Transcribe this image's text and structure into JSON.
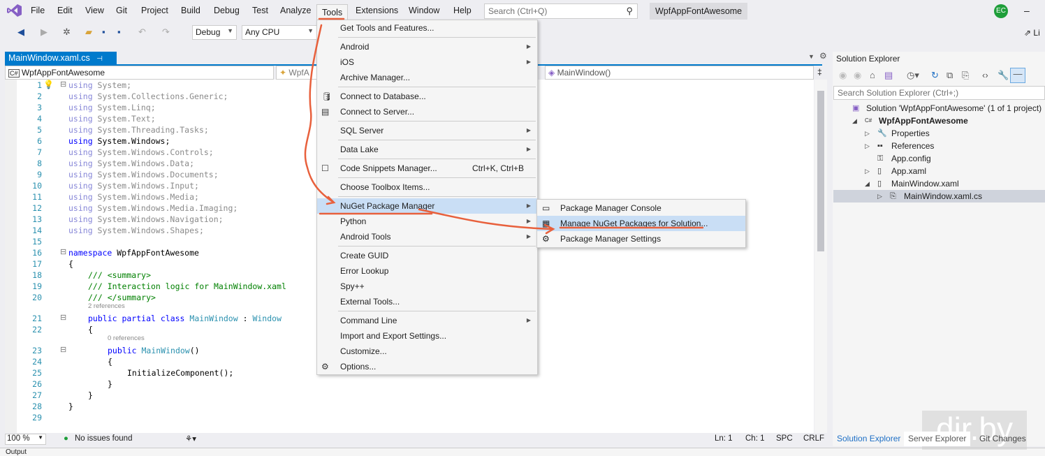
{
  "menubar": {
    "items": [
      "File",
      "Edit",
      "View",
      "Git",
      "Project",
      "Build",
      "Debug",
      "Test",
      "Analyze",
      "Tools",
      "Extensions",
      "Window",
      "Help"
    ],
    "active": "Tools",
    "search_placeholder": "Search (Ctrl+Q)",
    "solution_name": "WpfAppFontAwesome",
    "avatar_initials": "EC",
    "live_share": "Li"
  },
  "toolbar": {
    "configuration": "Debug",
    "platform": "Any CPU"
  },
  "editor": {
    "tab_label": "MainWindow.xaml.cs",
    "nav_project": "WpfAppFontAwesome",
    "nav_class": "WpfA",
    "nav_member": "MainWindow()",
    "lines": [
      {
        "n": "1",
        "indent": 0,
        "t": [
          [
            "kwf",
            "using"
          ],
          [
            "tf",
            " System;"
          ]
        ]
      },
      {
        "n": "2",
        "indent": 0,
        "t": [
          [
            "kwf",
            "using"
          ],
          [
            "tf",
            " System.Collections.Generic;"
          ]
        ]
      },
      {
        "n": "3",
        "indent": 0,
        "t": [
          [
            "kwf",
            "using"
          ],
          [
            "tf",
            " System.Linq;"
          ]
        ]
      },
      {
        "n": "4",
        "indent": 0,
        "t": [
          [
            "kwf",
            "using"
          ],
          [
            "tf",
            " System.Text;"
          ]
        ]
      },
      {
        "n": "5",
        "indent": 0,
        "t": [
          [
            "kwf",
            "using"
          ],
          [
            "tf",
            " System.Threading.Tasks;"
          ]
        ]
      },
      {
        "n": "6",
        "indent": 0,
        "t": [
          [
            "kw",
            "using"
          ],
          [
            "tx",
            " System.Windows;"
          ]
        ]
      },
      {
        "n": "7",
        "indent": 0,
        "t": [
          [
            "kwf",
            "using"
          ],
          [
            "tf",
            " System.Windows.Controls;"
          ]
        ]
      },
      {
        "n": "8",
        "indent": 0,
        "t": [
          [
            "kwf",
            "using"
          ],
          [
            "tf",
            " System.Windows.Data;"
          ]
        ]
      },
      {
        "n": "9",
        "indent": 0,
        "t": [
          [
            "kwf",
            "using"
          ],
          [
            "tf",
            " System.Windows.Documents;"
          ]
        ]
      },
      {
        "n": "10",
        "indent": 0,
        "t": [
          [
            "kwf",
            "using"
          ],
          [
            "tf",
            " System.Windows.Input;"
          ]
        ]
      },
      {
        "n": "11",
        "indent": 0,
        "t": [
          [
            "kwf",
            "using"
          ],
          [
            "tf",
            " System.Windows.Media;"
          ]
        ]
      },
      {
        "n": "12",
        "indent": 0,
        "t": [
          [
            "kwf",
            "using"
          ],
          [
            "tf",
            " System.Windows.Media.Imaging;"
          ]
        ]
      },
      {
        "n": "13",
        "indent": 0,
        "t": [
          [
            "kwf",
            "using"
          ],
          [
            "tf",
            " System.Windows.Navigation;"
          ]
        ]
      },
      {
        "n": "14",
        "indent": 0,
        "t": [
          [
            "kwf",
            "using"
          ],
          [
            "tf",
            " System.Windows.Shapes;"
          ]
        ]
      },
      {
        "n": "15",
        "indent": 0,
        "t": []
      },
      {
        "n": "16",
        "indent": 0,
        "t": [
          [
            "kw",
            "namespace"
          ],
          [
            "tx",
            " WpfAppFontAwesome"
          ]
        ]
      },
      {
        "n": "17",
        "indent": 0,
        "t": [
          [
            "tx",
            "{"
          ]
        ]
      },
      {
        "n": "18",
        "indent": 1,
        "t": [
          [
            "cm",
            "/// <summary>"
          ]
        ]
      },
      {
        "n": "19",
        "indent": 1,
        "t": [
          [
            "cm",
            "/// Interaction logic for MainWindow.xaml"
          ]
        ]
      },
      {
        "n": "20",
        "indent": 1,
        "t": [
          [
            "cm",
            "/// </summary>"
          ]
        ],
        "lens_after": "2 references"
      },
      {
        "n": "21",
        "indent": 1,
        "t": [
          [
            "kw",
            "public partial class"
          ],
          [
            "tx",
            " "
          ],
          [
            "ty",
            "MainWindow"
          ],
          [
            "tx",
            " : "
          ],
          [
            "ty",
            "Window"
          ]
        ]
      },
      {
        "n": "22",
        "indent": 1,
        "t": [
          [
            "tx",
            "{"
          ]
        ],
        "lens_after": "0 references"
      },
      {
        "n": "23",
        "indent": 2,
        "t": [
          [
            "kw",
            "public"
          ],
          [
            "tx",
            " "
          ],
          [
            "ty",
            "MainWindow"
          ],
          [
            "tx",
            "()"
          ]
        ]
      },
      {
        "n": "24",
        "indent": 2,
        "t": [
          [
            "tx",
            "{"
          ]
        ]
      },
      {
        "n": "25",
        "indent": 3,
        "t": [
          [
            "tx",
            "InitializeComponent();"
          ]
        ]
      },
      {
        "n": "26",
        "indent": 2,
        "t": [
          [
            "tx",
            "}"
          ]
        ]
      },
      {
        "n": "27",
        "indent": 1,
        "t": [
          [
            "tx",
            "}"
          ]
        ]
      },
      {
        "n": "28",
        "indent": 0,
        "t": [
          [
            "tx",
            "}"
          ]
        ]
      },
      {
        "n": "29",
        "indent": 0,
        "t": []
      }
    ]
  },
  "tools_menu": [
    {
      "label": "Get Tools and Features..."
    },
    {
      "sep": true
    },
    {
      "label": "Android",
      "submenu": true
    },
    {
      "label": "iOS",
      "submenu": true
    },
    {
      "label": "Archive Manager..."
    },
    {
      "sep": true
    },
    {
      "label": "Connect to Database...",
      "icon": "database-icon",
      "glyph": "🛢"
    },
    {
      "label": "Connect to Server...",
      "icon": "server-icon",
      "glyph": "▤"
    },
    {
      "sep": true
    },
    {
      "label": "SQL Server",
      "submenu": true
    },
    {
      "sep": true
    },
    {
      "label": "Data Lake",
      "submenu": true
    },
    {
      "sep": true
    },
    {
      "label": "Code Snippets Manager...",
      "shortcut": "Ctrl+K, Ctrl+B",
      "icon": "snippet-icon",
      "glyph": "☐"
    },
    {
      "sep": true
    },
    {
      "label": "Choose Toolbox Items..."
    },
    {
      "sep": true
    },
    {
      "label": "NuGet Package Manager",
      "submenu": true,
      "highlighted": true
    },
    {
      "label": "Python",
      "submenu": true
    },
    {
      "label": "Android Tools",
      "submenu": true
    },
    {
      "sep": true
    },
    {
      "label": "Create GUID"
    },
    {
      "label": "Error Lookup"
    },
    {
      "label": "Spy++"
    },
    {
      "label": "External Tools..."
    },
    {
      "sep": true
    },
    {
      "label": "Command Line",
      "submenu": true
    },
    {
      "label": "Import and Export Settings..."
    },
    {
      "label": "Customize..."
    },
    {
      "label": "Options...",
      "icon": "gear-icon",
      "glyph": "⚙"
    }
  ],
  "nuget_submenu": [
    {
      "label": "Package Manager Console",
      "icon": "console-icon",
      "glyph": "▭"
    },
    {
      "label": "Manage NuGet Packages for Solution...",
      "icon": "package-icon",
      "glyph": "▦",
      "highlighted": true
    },
    {
      "label": "Package Manager Settings",
      "icon": "gear-icon",
      "glyph": "⚙"
    }
  ],
  "status": {
    "zoom": "100 %",
    "issues": "No issues found",
    "ln": "Ln: 1",
    "ch": "Ch: 1",
    "spc": "SPC",
    "crlf": "CRLF"
  },
  "solution_explorer": {
    "title": "Solution Explorer",
    "search_placeholder": "Search Solution Explorer (Ctrl+;)",
    "tree": [
      {
        "label": "Solution 'WpfAppFontAwesome' (1 of 1 project)",
        "icon": "solution-icon",
        "level": 0
      },
      {
        "label": "WpfAppFontAwesome",
        "icon": "csharp-project-icon",
        "level": 1,
        "expanded": true,
        "bold": true
      },
      {
        "label": "Properties",
        "icon": "wrench-icon",
        "level": 2,
        "collapsed": true
      },
      {
        "label": "References",
        "icon": "references-icon",
        "level": 2,
        "collapsed": true
      },
      {
        "label": "App.config",
        "icon": "config-file-icon",
        "level": 2
      },
      {
        "label": "App.xaml",
        "icon": "xaml-file-icon",
        "level": 2,
        "collapsed": true
      },
      {
        "label": "MainWindow.xaml",
        "icon": "xaml-file-icon",
        "level": 2,
        "expanded": true
      },
      {
        "label": "MainWindow.xaml.cs",
        "icon": "cs-file-icon",
        "level": 3,
        "collapsed": true,
        "selected": true
      }
    ],
    "tabs": [
      "Solution Explorer",
      "Server Explorer",
      "Git Changes"
    ]
  },
  "watermark": "dir.by",
  "output_label": "Output",
  "colors": {
    "accent": "#007acc",
    "menu_highlight": "#c9def5",
    "annotation": "#e8603c",
    "vs_purple": "#865fc5"
  }
}
